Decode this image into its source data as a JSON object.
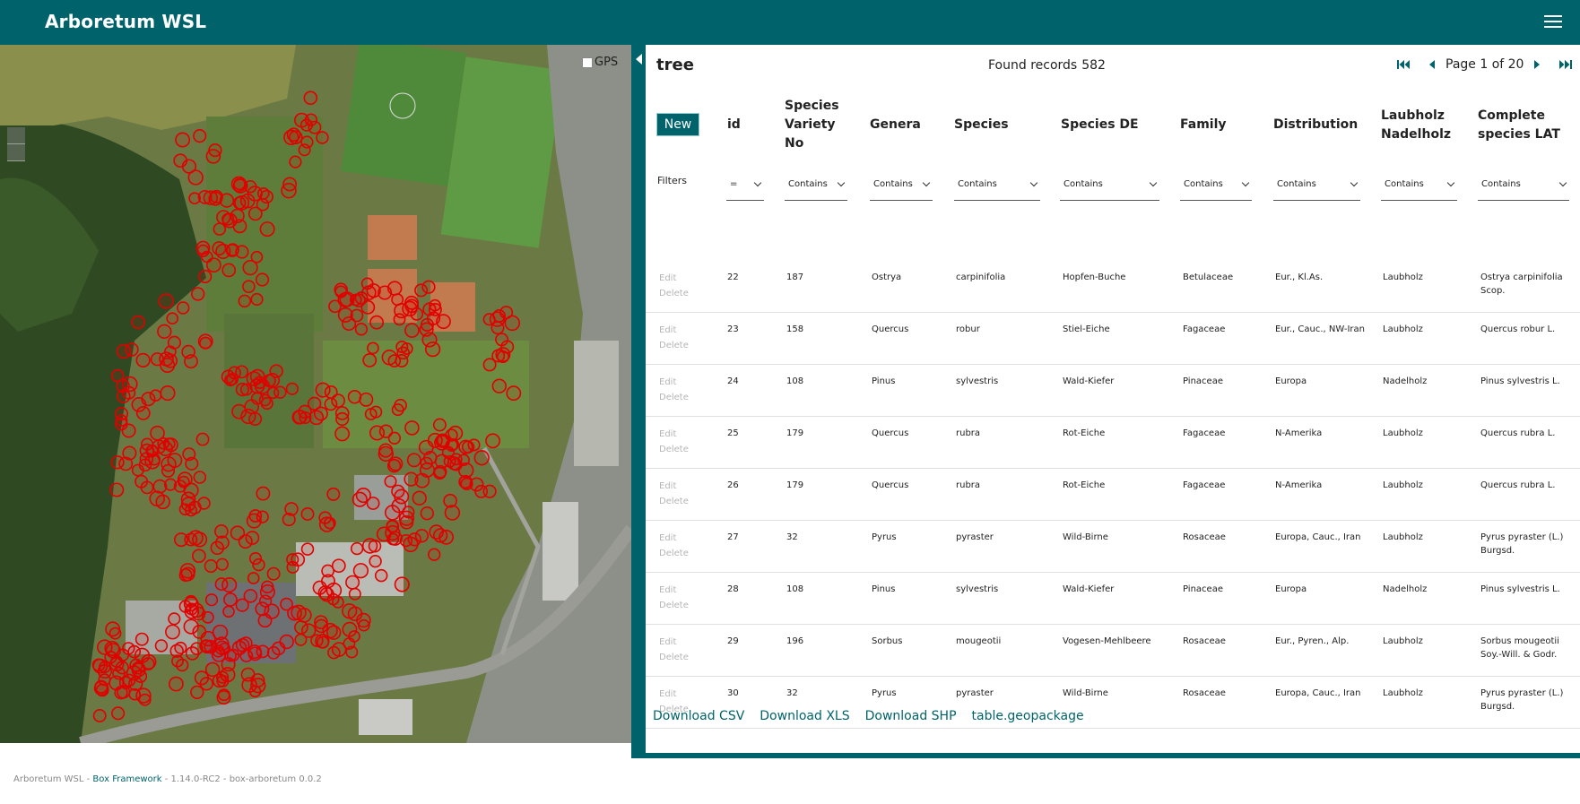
{
  "app": {
    "title": "Arboretum WSL",
    "menu_icon": "hamburger-menu-icon"
  },
  "map": {
    "gps_label": "GPS",
    "gps_checked": false,
    "marker_color": "#e00000"
  },
  "table": {
    "title": "tree",
    "found_label": "Found records",
    "found_count": "582",
    "page_label": "Page 1 of 20",
    "new_label": "New",
    "filters_label": "Filters",
    "columns": [
      {
        "label": "id",
        "filter": "="
      },
      {
        "label": "Species Variety No",
        "filter": "Contains"
      },
      {
        "label": "Genera",
        "filter": "Contains"
      },
      {
        "label": "Species",
        "filter": "Contains"
      },
      {
        "label": "Species DE",
        "filter": "Contains"
      },
      {
        "label": "Family",
        "filter": "Contains"
      },
      {
        "label": "Distribution",
        "filter": "Contains"
      },
      {
        "label": "Laubholz Nadelholz",
        "filter": "Contains"
      },
      {
        "label": "Complete species LAT",
        "filter": "Contains"
      }
    ],
    "edit_label": "Edit",
    "delete_label": "Delete",
    "rows": [
      [
        "22",
        "187",
        "Ostrya",
        "carpinifolia",
        "Hopfen-Buche",
        "Betulaceae",
        "Eur., Kl.As.",
        "Laubholz",
        "Ostrya carpinifolia Scop."
      ],
      [
        "23",
        "158",
        "Quercus",
        "robur",
        "Stiel-Eiche",
        "Fagaceae",
        "Eur., Cauc., NW-Iran",
        "Laubholz",
        "Quercus robur L."
      ],
      [
        "24",
        "108",
        "Pinus",
        "sylvestris",
        "Wald-Kiefer",
        "Pinaceae",
        "Europa",
        "Nadelholz",
        "Pinus sylvestris L."
      ],
      [
        "25",
        "179",
        "Quercus",
        "rubra",
        "Rot-Eiche",
        "Fagaceae",
        "N-Amerika",
        "Laubholz",
        "Quercus rubra L."
      ],
      [
        "26",
        "179",
        "Quercus",
        "rubra",
        "Rot-Eiche",
        "Fagaceae",
        "N-Amerika",
        "Laubholz",
        "Quercus rubra L."
      ],
      [
        "27",
        "32",
        "Pyrus",
        "pyraster",
        "Wild-Birne",
        "Rosaceae",
        "Europa, Cauc., Iran",
        "Laubholz",
        "Pyrus pyraster (L.) Burgsd."
      ],
      [
        "28",
        "108",
        "Pinus",
        "sylvestris",
        "Wald-Kiefer",
        "Pinaceae",
        "Europa",
        "Nadelholz",
        "Pinus sylvestris L."
      ],
      [
        "29",
        "196",
        "Sorbus",
        "mougeotii",
        "Vogesen-Mehlbeere",
        "Rosaceae",
        "Eur., Pyren., Alp.",
        "Laubholz",
        "Sorbus mougeotii Soy.-Will. & Godr."
      ],
      [
        "30",
        "32",
        "Pyrus",
        "pyraster",
        "Wild-Birne",
        "Rosaceae",
        "Europa, Cauc., Iran",
        "Laubholz",
        "Pyrus pyraster (L.) Burgsd."
      ]
    ],
    "downloads": [
      "Download CSV",
      "Download XLS",
      "Download SHP",
      "table.geopackage"
    ]
  },
  "footer": {
    "app_name": "Arboretum WSL",
    "sep": " - ",
    "framework_link": "Box Framework",
    "version": "1.14.0-RC2",
    "build": "box-arboretum 0.0.2"
  },
  "colors": {
    "primary": "#00636b",
    "marker": "#e00000"
  }
}
